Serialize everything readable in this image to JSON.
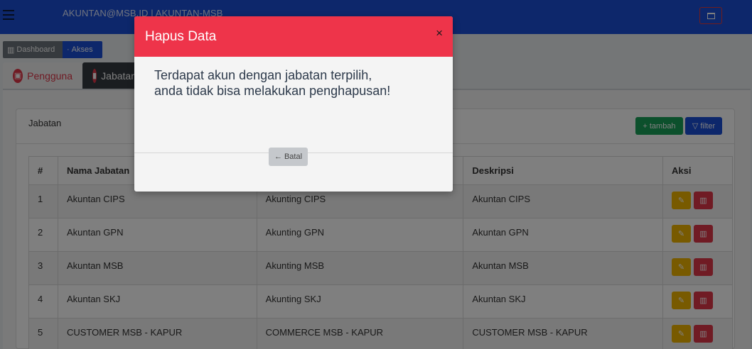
{
  "topbar": {
    "user_text": "AKUNTAN@MSB.ID | AKUNTAN-MSB"
  },
  "breadcrumb": {
    "dashboard": "Dashboard",
    "akses": "Akses"
  },
  "tabs": {
    "pengguna": "Pengguna",
    "jabatan": "Jabatan"
  },
  "card": {
    "title": "Jabatan",
    "tambah": "tambah",
    "filter": "filter"
  },
  "table": {
    "headers": [
      "#",
      "Nama Jabatan",
      "",
      "Deskripsi",
      "Aksi"
    ],
    "rows": [
      [
        "1",
        "Akuntan CIPS",
        "Akunting CIPS",
        "Akuntan CIPS"
      ],
      [
        "2",
        "Akuntan GPN",
        "Akunting GPN",
        "Akuntan GPN"
      ],
      [
        "3",
        "Akuntan MSB",
        "Akunting MSB",
        "Akuntan MSB"
      ],
      [
        "4",
        "Akuntan SKJ",
        "Akunting SKJ",
        "Akuntan SKJ"
      ],
      [
        "5",
        "CUSTOMER MSB - KAPUR",
        "COMMERCE MSB - KAPUR",
        "CUSTOMER MSB - KAPUR"
      ]
    ]
  },
  "modal": {
    "title": "Hapus Data",
    "close": "×",
    "message": "Terdapat akun dengan jabatan terpilih, anda tidak bisa melakukan penghapusan!",
    "batal": "Batal"
  },
  "colors": {
    "topbar": "#1a4fd6",
    "modal_header": "#ee344a",
    "edit": "#f0b400",
    "delete": "#e13649",
    "tambah": "#18a058"
  }
}
